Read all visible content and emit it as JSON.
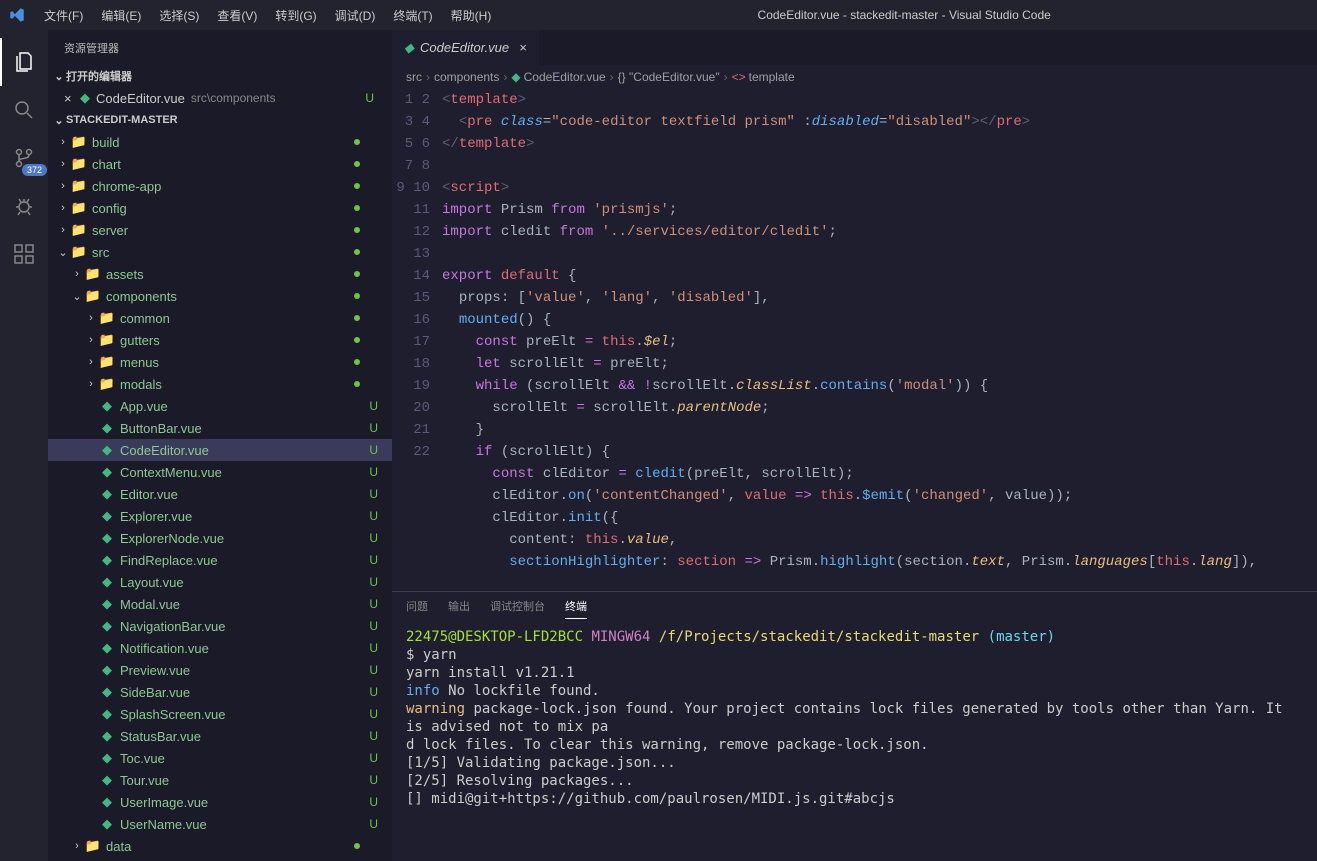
{
  "window": {
    "title": "CodeEditor.vue - stackedit-master - Visual Studio Code"
  },
  "menu": [
    "文件(F)",
    "编辑(E)",
    "选择(S)",
    "查看(V)",
    "转到(G)",
    "调试(D)",
    "终端(T)",
    "帮助(H)"
  ],
  "activity": {
    "scm_badge": "372"
  },
  "sidebar": {
    "title": "资源管理器",
    "open_editors_label": "打开的编辑器",
    "open_editor": {
      "name": "CodeEditor.vue",
      "path": "src\\components",
      "status": "U"
    },
    "workspace_label": "STACKEDIT-MASTER",
    "tree": [
      {
        "depth": 0,
        "type": "folder",
        "name": "build",
        "collapsed": true,
        "iconcls": "ic-folder",
        "dot": true
      },
      {
        "depth": 0,
        "type": "folder",
        "name": "chart",
        "collapsed": true,
        "iconcls": "ic-folder",
        "dot": true
      },
      {
        "depth": 0,
        "type": "folder",
        "name": "chrome-app",
        "collapsed": true,
        "iconcls": "ic-folder-blue",
        "dot": true
      },
      {
        "depth": 0,
        "type": "folder",
        "name": "config",
        "collapsed": true,
        "iconcls": "ic-folder-blue",
        "dot": true
      },
      {
        "depth": 0,
        "type": "folder",
        "name": "server",
        "collapsed": true,
        "iconcls": "ic-folder",
        "dot": true
      },
      {
        "depth": 0,
        "type": "folder",
        "name": "src",
        "collapsed": false,
        "iconcls": "ic-folder-src",
        "dot": true
      },
      {
        "depth": 1,
        "type": "folder",
        "name": "assets",
        "collapsed": true,
        "iconcls": "ic-folder",
        "dot": true
      },
      {
        "depth": 1,
        "type": "folder",
        "name": "components",
        "collapsed": false,
        "iconcls": "ic-folder",
        "dot": true
      },
      {
        "depth": 2,
        "type": "folder",
        "name": "common",
        "collapsed": true,
        "iconcls": "ic-folder",
        "dot": true
      },
      {
        "depth": 2,
        "type": "folder",
        "name": "gutters",
        "collapsed": true,
        "iconcls": "ic-folder",
        "dot": true
      },
      {
        "depth": 2,
        "type": "folder",
        "name": "menus",
        "collapsed": true,
        "iconcls": "ic-folder",
        "dot": true
      },
      {
        "depth": 2,
        "type": "folder",
        "name": "modals",
        "collapsed": true,
        "iconcls": "ic-folder",
        "dot": true
      },
      {
        "depth": 2,
        "type": "file",
        "name": "App.vue",
        "u": "U",
        "iconcls": "ic-vue"
      },
      {
        "depth": 2,
        "type": "file",
        "name": "ButtonBar.vue",
        "u": "U",
        "iconcls": "ic-vue"
      },
      {
        "depth": 2,
        "type": "file",
        "name": "CodeEditor.vue",
        "u": "U",
        "iconcls": "ic-vue",
        "selected": true
      },
      {
        "depth": 2,
        "type": "file",
        "name": "ContextMenu.vue",
        "u": "U",
        "iconcls": "ic-vue"
      },
      {
        "depth": 2,
        "type": "file",
        "name": "Editor.vue",
        "u": "U",
        "iconcls": "ic-vue"
      },
      {
        "depth": 2,
        "type": "file",
        "name": "Explorer.vue",
        "u": "U",
        "iconcls": "ic-vue"
      },
      {
        "depth": 2,
        "type": "file",
        "name": "ExplorerNode.vue",
        "u": "U",
        "iconcls": "ic-vue"
      },
      {
        "depth": 2,
        "type": "file",
        "name": "FindReplace.vue",
        "u": "U",
        "iconcls": "ic-vue"
      },
      {
        "depth": 2,
        "type": "file",
        "name": "Layout.vue",
        "u": "U",
        "iconcls": "ic-vue"
      },
      {
        "depth": 2,
        "type": "file",
        "name": "Modal.vue",
        "u": "U",
        "iconcls": "ic-vue"
      },
      {
        "depth": 2,
        "type": "file",
        "name": "NavigationBar.vue",
        "u": "U",
        "iconcls": "ic-vue"
      },
      {
        "depth": 2,
        "type": "file",
        "name": "Notification.vue",
        "u": "U",
        "iconcls": "ic-vue"
      },
      {
        "depth": 2,
        "type": "file",
        "name": "Preview.vue",
        "u": "U",
        "iconcls": "ic-vue"
      },
      {
        "depth": 2,
        "type": "file",
        "name": "SideBar.vue",
        "u": "U",
        "iconcls": "ic-vue"
      },
      {
        "depth": 2,
        "type": "file",
        "name": "SplashScreen.vue",
        "u": "U",
        "iconcls": "ic-vue"
      },
      {
        "depth": 2,
        "type": "file",
        "name": "StatusBar.vue",
        "u": "U",
        "iconcls": "ic-vue"
      },
      {
        "depth": 2,
        "type": "file",
        "name": "Toc.vue",
        "u": "U",
        "iconcls": "ic-vue"
      },
      {
        "depth": 2,
        "type": "file",
        "name": "Tour.vue",
        "u": "U",
        "iconcls": "ic-vue"
      },
      {
        "depth": 2,
        "type": "file",
        "name": "UserImage.vue",
        "u": "U",
        "iconcls": "ic-vue"
      },
      {
        "depth": 2,
        "type": "file",
        "name": "UserName.vue",
        "u": "U",
        "iconcls": "ic-vue"
      },
      {
        "depth": 1,
        "type": "folder",
        "name": "data",
        "collapsed": true,
        "iconcls": "ic-folder",
        "dot": true
      }
    ]
  },
  "tab": {
    "name": "CodeEditor.vue"
  },
  "breadcrumb": [
    "src",
    "components",
    "CodeEditor.vue",
    "{} \"CodeEditor.vue\"",
    "template"
  ],
  "code_lines": [
    "1",
    "2",
    "3",
    "4",
    "5",
    "6",
    "7",
    "8",
    "9",
    "10",
    "11",
    "12",
    "13",
    "14",
    "15",
    "16",
    "17",
    "18",
    "19",
    "20",
    "21",
    "22"
  ],
  "panel": {
    "tabs": [
      "问题",
      "输出",
      "调试控制台",
      "终端"
    ],
    "active": "终端",
    "terminal": {
      "user": "22475@DESKTOP-LFD2BCC",
      "shell": "MINGW64",
      "cwd": "/f/Projects/stackedit/stackedit-master",
      "branch": "(master)",
      "cmd": "$ yarn",
      "l1": "yarn install v1.21.1",
      "l2_tag": "info",
      "l2": " No lockfile found.",
      "l3_tag": "warning",
      "l3": " package-lock.json found. Your project contains lock files generated by tools other than Yarn. It is advised not to mix pa",
      "l3b": "d lock files. To clear this warning, remove package-lock.json.",
      "l4": "[1/5] Validating package.json...",
      "l5": "[2/5] Resolving packages...",
      "l6": "[] midi@git+https://github.com/paulrosen/MIDI.js.git#abcjs"
    }
  }
}
